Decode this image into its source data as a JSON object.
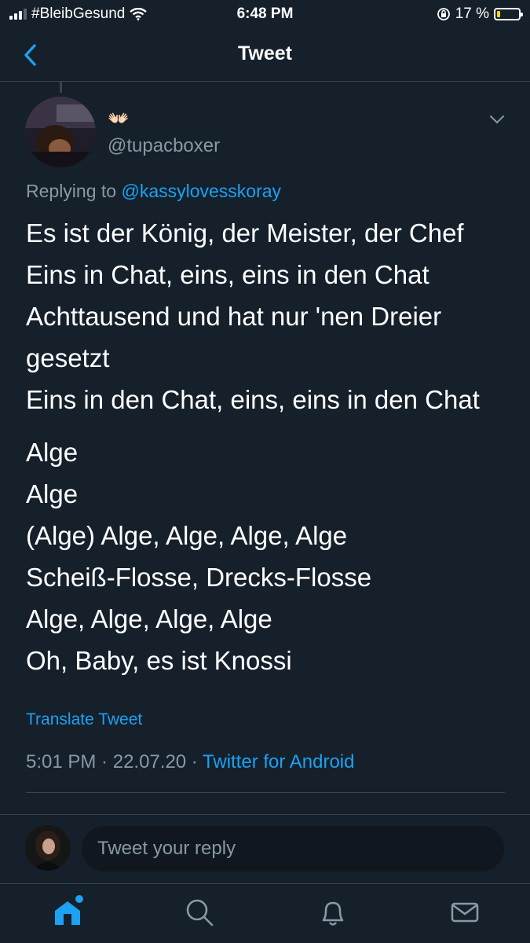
{
  "status_bar": {
    "carrier": "#BleibGesund",
    "time": "6:48 PM",
    "battery_percent": "17 %",
    "battery_level": 0.17,
    "battery_color": "#f5d90a"
  },
  "header": {
    "title": "Tweet"
  },
  "tweet": {
    "display_name": "👐🏻",
    "handle": "@tupacboxer",
    "replying_prefix": "Replying to ",
    "replying_to": "@kassylovesskoray",
    "lines": [
      "Es ist der König, der Meister, der Chef",
      "Eins in Chat, eins, eins in den Chat",
      "Achttausend und hat nur 'nen Dreier",
      "gesetzt",
      "Eins in den Chat, eins, eins in den Chat"
    ],
    "lines2": [
      "Alge",
      "Alge",
      "(Alge) Alge, Alge, Alge, Alge",
      "Scheiß-Flosse, Drecks-Flosse",
      "Alge, Alge, Alge, Alge",
      "Oh, Baby, es ist Knossi"
    ],
    "translate_label": "Translate Tweet",
    "time": "5:01 PM",
    "sep1": " · ",
    "date": "22.07.20",
    "sep2": " · ",
    "source": "Twitter for Android"
  },
  "reply": {
    "placeholder": "Tweet your reply"
  },
  "icons": {
    "accent": "#1da1f2",
    "tabs": [
      "home-icon",
      "search-icon",
      "notifications-icon",
      "messages-icon"
    ]
  }
}
